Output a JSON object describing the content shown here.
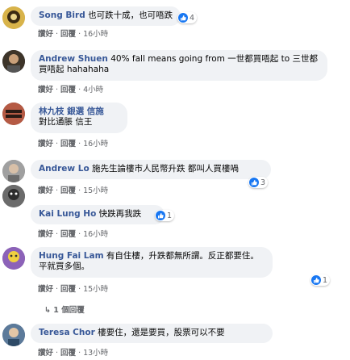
{
  "comments": [
    {
      "author": "Song Bird",
      "text": "也可跌十成，也可唔跌",
      "reactions": "4",
      "time": "16小時",
      "like": "讚好",
      "reply": "回覆"
    },
    {
      "author": "Andrew Shuen",
      "text": "40% fall means going from 一世都買唔起 to 三世都買唔起 hahahaha",
      "reactions": "",
      "time": "4小時",
      "like": "讚好",
      "reply": "回覆"
    },
    {
      "author": "林九枝 銀選 信施",
      "text": "對比通脹 信王",
      "reactions": "",
      "time": "16小時",
      "like": "讚好",
      "reply": "回覆"
    },
    {
      "author": "Andrew Lo",
      "text": "施先生論樓市人民幣升跌 都叫人買樓喎",
      "reactions": "3",
      "time": "15小時",
      "like": "讚好",
      "reply": "回覆"
    },
    {
      "author": "Kai Lung Ho",
      "text": "快跌再我跌",
      "reactions": "1",
      "time": "16小時",
      "like": "讚好",
      "reply": "回覆"
    },
    {
      "author": "Hung Fai Lam",
      "text": "有自住樓，升跌都無所謂。反正都要住。平就買多個。",
      "reactions": "1",
      "time": "15小時",
      "like": "讚好",
      "reply": "回覆",
      "replies": "1 個回覆"
    },
    {
      "author": "Teresa Chor",
      "text": "樓要住，還是要買，股票可以不要",
      "reactions": "",
      "time": "13小時",
      "like": "讚好",
      "reply": "回覆"
    }
  ],
  "colors": {
    "link": "#385898",
    "bubble": "#f0f2f5",
    "muted": "#65676b",
    "like": "#1877f2"
  }
}
